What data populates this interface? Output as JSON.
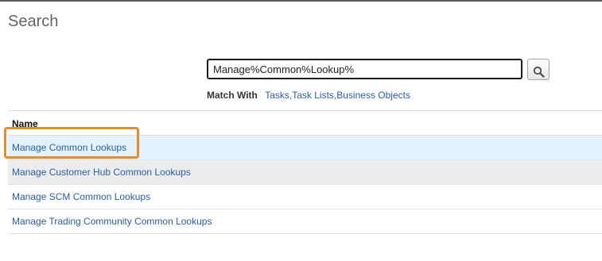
{
  "page": {
    "title": "Search"
  },
  "search": {
    "value": "Manage%Common%Lookup%",
    "button_icon": "magnifier-icon"
  },
  "match_with": {
    "label": "Match With",
    "value": "Tasks,Task Lists,Business Objects"
  },
  "results": {
    "column_header": "Name",
    "rows": [
      {
        "name": "Manage Common Lookups",
        "state": "selected"
      },
      {
        "name": "Manage Customer Hub Common Lookups",
        "state": "shaded"
      },
      {
        "name": "Manage SCM Common Lookups",
        "state": "normal"
      },
      {
        "name": "Manage Trading Community Common Lookups",
        "state": "normal"
      }
    ]
  },
  "colors": {
    "link": "#2a5ea6",
    "selected_row": "#e3f2fc",
    "highlight": "#e98a2c"
  }
}
